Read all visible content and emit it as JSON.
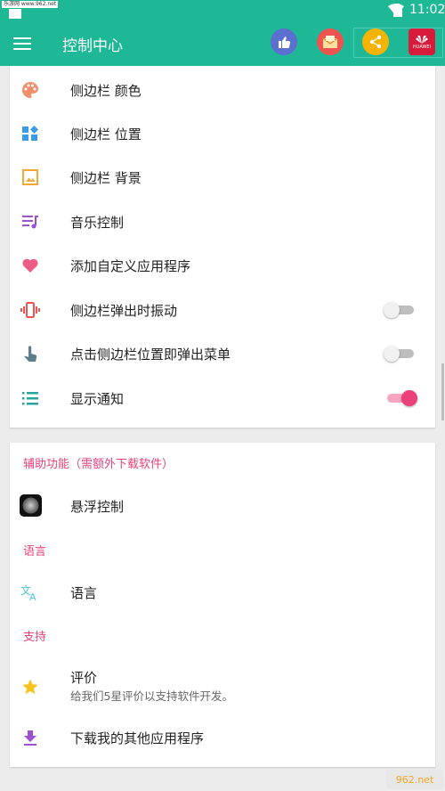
{
  "statusbar": {
    "watermark": "乐游网 www.962.net",
    "time": "11:02"
  },
  "appbar": {
    "title": "控制中心",
    "actions": [
      "thumbs-up-icon",
      "mail-icon",
      "share-icon",
      "huawei-icon"
    ],
    "huawei_text": "HUAWEI",
    "colors": {
      "bg": "#1fb896",
      "like": "#5b6fd0",
      "mail": "#ef5350",
      "share": "#f5b400",
      "huawei": "#d81b3a"
    }
  },
  "settings": {
    "items": [
      {
        "label": "侧边栏 颜色",
        "icon": "palette-icon",
        "color": "#f08f6c"
      },
      {
        "label": "侧边栏 位置",
        "icon": "widgets-icon",
        "color": "#3b9be6"
      },
      {
        "label": "侧边栏 背景",
        "icon": "image-icon",
        "color": "#f3a736"
      },
      {
        "label": "音乐控制",
        "icon": "music-queue-icon",
        "color": "#9c4fd1"
      },
      {
        "label": "添加自定义应用程序",
        "icon": "heart-icon",
        "color": "#ec5c85"
      },
      {
        "label": "侧边栏弹出时振动",
        "icon": "vibration-icon",
        "color": "#ef5350",
        "toggle": false
      },
      {
        "label": "点击侧边栏位置即弹出菜单",
        "icon": "touch-icon",
        "color": "#607d8b",
        "toggle": false
      },
      {
        "label": "显示通知",
        "icon": "list-icon",
        "color": "#26a69a",
        "toggle": true
      }
    ]
  },
  "extra": {
    "section_accessibility": "辅助功能（需额外下载软件）",
    "floating_control": "悬浮控制",
    "section_language": "语言",
    "language": "语言",
    "section_support": "支持",
    "rate": "评价",
    "rate_sub": "给我们5星评价以支持软件开发。",
    "download_other": "下载我的其他应用程序"
  },
  "footer_watermark": "962.net",
  "colors": {
    "accent": "#e8417c",
    "toggle_on": "#ec407a"
  }
}
